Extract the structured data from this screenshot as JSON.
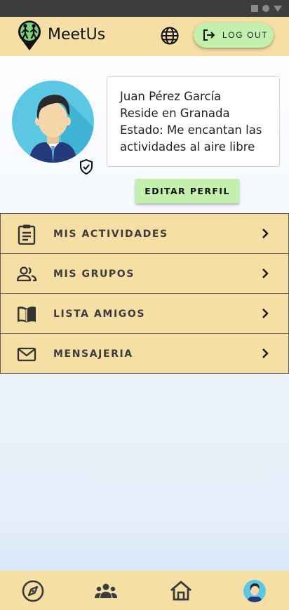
{
  "app": {
    "title": "MeetUs",
    "logout_label": "LOG OUT",
    "brand_color": "#f5dfa5",
    "accent_color": "#c4f0ae"
  },
  "profile": {
    "name": "Juan Pérez García",
    "residence": "Reside en Granada",
    "status_line1": "Estado: Me encantan las",
    "status_line2": "actividades al aire libre",
    "edit_label": "EDITAR PERFIL",
    "verified_icon": "shield-check-icon"
  },
  "menu": {
    "items": [
      {
        "label": "MIS ACTIVIDADES",
        "icon": "clipboard-icon"
      },
      {
        "label": "MIS GRUPOS",
        "icon": "people-icon"
      },
      {
        "label": "LISTA AMIGOS",
        "icon": "book-icon"
      },
      {
        "label": "MENSAJERIA",
        "icon": "mail-icon"
      }
    ]
  },
  "bottom_nav": {
    "items": [
      {
        "icon": "compass-icon"
      },
      {
        "icon": "groups-icon"
      },
      {
        "icon": "home-icon"
      },
      {
        "icon": "profile-avatar-icon"
      }
    ]
  }
}
